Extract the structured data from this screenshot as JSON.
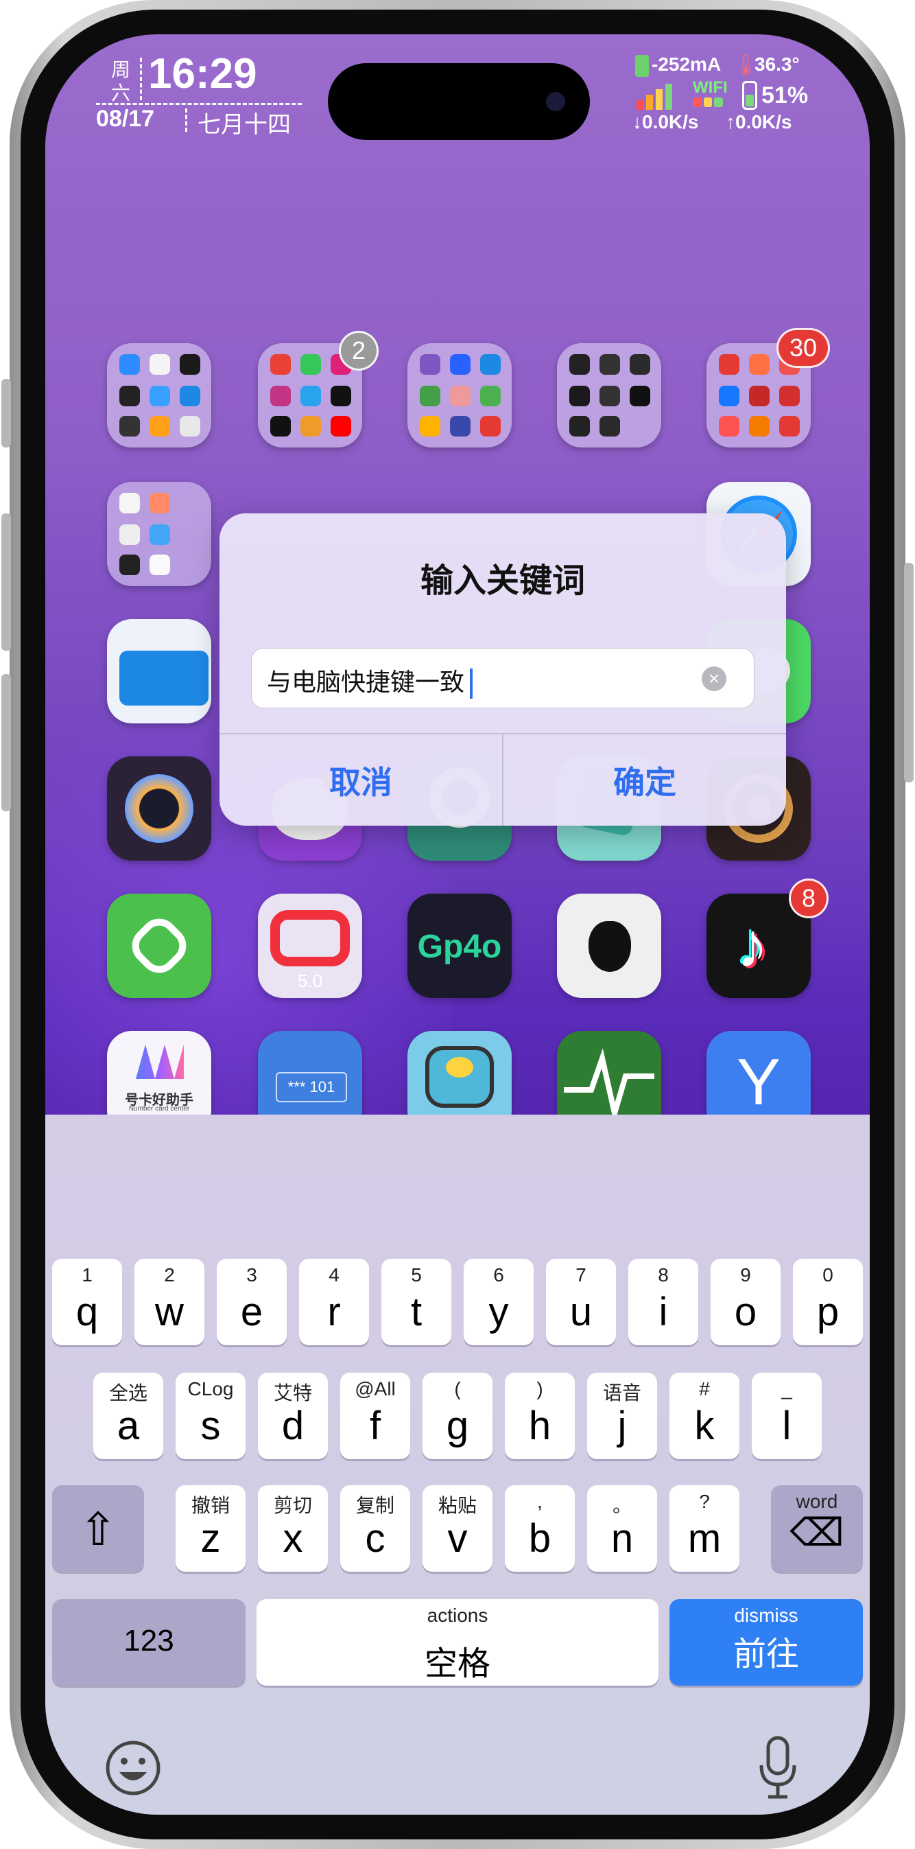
{
  "status_bar": {
    "weekday_top": "周",
    "weekday_bottom": "六",
    "time": "16:29",
    "date": "08/17",
    "lunar_date": "七月十四",
    "current": "-252mA",
    "temperature": "36.3°",
    "wifi_label": "WIFI",
    "battery_percent": "51%",
    "battery_level": 0.51,
    "download_speed": "↓0.0K/s",
    "upload_speed": "↑0.0K/s"
  },
  "home_screen": {
    "badges": [
      "2",
      "30",
      "8"
    ],
    "app_labels": {
      "number_card_line1": "号卡好助手",
      "number_card_line2": "Number card center",
      "quick_app_version": "5.0",
      "gp4o_text": "Gp4o",
      "password_text": "*** 101"
    }
  },
  "dialog": {
    "title": "输入关键词",
    "input_value": "与电脑快捷键一致",
    "clear_icon": "×",
    "cancel_label": "取消",
    "confirm_label": "确定"
  },
  "keyboard": {
    "row1": [
      {
        "hint": "1",
        "key": "q"
      },
      {
        "hint": "2",
        "key": "w"
      },
      {
        "hint": "3",
        "key": "e"
      },
      {
        "hint": "4",
        "key": "r"
      },
      {
        "hint": "5",
        "key": "t"
      },
      {
        "hint": "6",
        "key": "y"
      },
      {
        "hint": "7",
        "key": "u"
      },
      {
        "hint": "8",
        "key": "i"
      },
      {
        "hint": "9",
        "key": "o"
      },
      {
        "hint": "0",
        "key": "p"
      }
    ],
    "row2": [
      {
        "hint": "全选",
        "key": "a"
      },
      {
        "hint": "CLog",
        "key": "s"
      },
      {
        "hint": "艾特",
        "key": "d"
      },
      {
        "hint": "@All",
        "key": "f"
      },
      {
        "hint": "(",
        "key": "g"
      },
      {
        "hint": ")",
        "key": "h"
      },
      {
        "hint": "语音",
        "key": "j"
      },
      {
        "hint": "#",
        "key": "k"
      },
      {
        "hint": "_",
        "key": "l"
      }
    ],
    "row3": [
      {
        "hint": "撤销",
        "key": "z"
      },
      {
        "hint": "剪切",
        "key": "x"
      },
      {
        "hint": "复制",
        "key": "c"
      },
      {
        "hint": "粘贴",
        "key": "v"
      },
      {
        "hint": ",",
        "key": "b"
      },
      {
        "hint": "。",
        "key": "n"
      },
      {
        "hint": "?",
        "key": "m"
      }
    ],
    "shift_icon": "⇧",
    "backspace_hint": "word",
    "backspace_icon": "⌫",
    "numbers_label": "123",
    "space_hint": "actions",
    "space_label": "空格",
    "go_hint": "dismiss",
    "go_label": "前往",
    "emoji_icon": "emoji-icon",
    "mic_icon": "microphone-icon"
  },
  "colors": {
    "accent": "#2f6ef0",
    "badge_red": "#e53935",
    "badge_gray": "#9a9a9a"
  }
}
